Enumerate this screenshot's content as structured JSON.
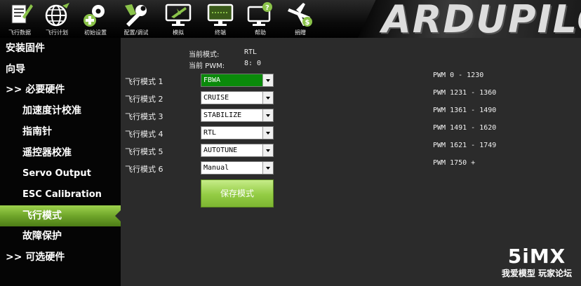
{
  "toolbar": {
    "buttons": [
      {
        "label": "飞行数据",
        "icon": "flight-data-icon"
      },
      {
        "label": "飞行计划",
        "icon": "globe-icon"
      },
      {
        "label": "初始设置",
        "icon": "gears-icon"
      },
      {
        "label": "配置/调试",
        "icon": "wrench-icon"
      },
      {
        "label": "模拟",
        "icon": "monitor-plane-icon"
      },
      {
        "label": "终端",
        "icon": "terminal-icon"
      },
      {
        "label": "帮助",
        "icon": "help-monitor-icon"
      },
      {
        "label": "捐赠",
        "icon": "donate-plane-icon"
      }
    ],
    "logo_text": "ARDUPILO"
  },
  "sidebar": {
    "items": [
      {
        "label": "安装固件"
      },
      {
        "label": "向导"
      },
      {
        "label": ">> 必要硬件"
      },
      {
        "label": "加速度计校准"
      },
      {
        "label": "指南针"
      },
      {
        "label": "遥控器校准"
      },
      {
        "label": "Servo Output"
      },
      {
        "label": "ESC Calibration"
      },
      {
        "label": "飞行模式"
      },
      {
        "label": "故障保护"
      },
      {
        "label": ">> 可选硬件"
      }
    ],
    "active_index": 8
  },
  "status": {
    "current_mode_label": "当前模式:",
    "current_mode_value": "RTL",
    "current_pwm_label": "当前 PWM:",
    "current_pwm_value": "8: 0"
  },
  "flight_modes": [
    {
      "label": "飞行模式 1",
      "value": "FBWA",
      "highlight": true
    },
    {
      "label": "飞行模式 2",
      "value": "CRUISE"
    },
    {
      "label": "飞行模式 3",
      "value": "STABILIZE"
    },
    {
      "label": "飞行模式 4",
      "value": "RTL"
    },
    {
      "label": "飞行模式 5",
      "value": "AUTOTUNE"
    },
    {
      "label": "飞行模式 6",
      "value": "Manual"
    }
  ],
  "pwm_ranges": [
    "PWM 0 - 1230",
    "PWM 1231 - 1360",
    "PWM 1361 - 1490",
    "PWM 1491 - 1620",
    "PWM 1621 - 1749",
    "PWM 1750 +"
  ],
  "save_button_label": "保存模式",
  "watermark": {
    "logo": "5iMX",
    "caption": "我爱模型 玩家论坛"
  },
  "colors": {
    "active_green": "#7db531",
    "highlight_select": "#0a8a0a",
    "panel_bg": "#2b2b2b"
  }
}
